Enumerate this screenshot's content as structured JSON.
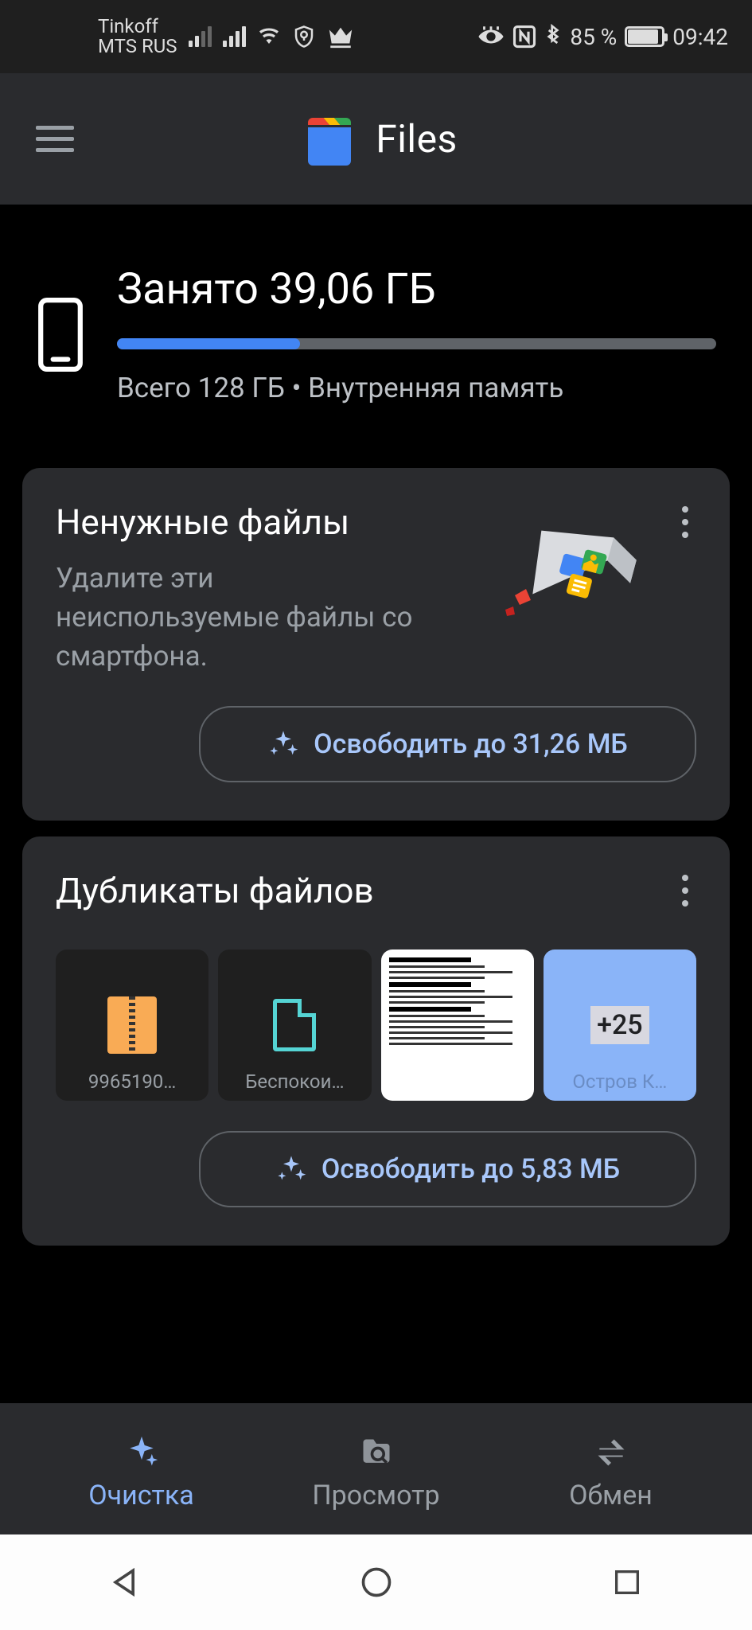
{
  "status_bar": {
    "carrier1": "Tinkoff",
    "carrier2": "MTS RUS",
    "battery_pct": "85 %",
    "time": "09:42"
  },
  "app_bar": {
    "title": "Files"
  },
  "storage": {
    "used_label": "Занято 39,06 ГБ",
    "progress_pct": 30.5,
    "total_label": "Всего 128 ГБ • Внутренняя память"
  },
  "cards": {
    "junk": {
      "title": "Ненужные файлы",
      "subtitle": "Удалите эти неиспользуемые файлы со смартфона.",
      "button": "Освободить до 31,26 МБ"
    },
    "duplicates": {
      "title": "Дубликаты файлов",
      "items": [
        {
          "label": "9965190…"
        },
        {
          "label": "Беспокои…"
        },
        {
          "label": ""
        },
        {
          "label": "Остров К…",
          "more": "+25"
        }
      ],
      "button": "Освободить до 5,83 МБ"
    }
  },
  "bottom_nav": {
    "clean": "Очистка",
    "browse": "Просмотр",
    "share": "Обмен"
  }
}
